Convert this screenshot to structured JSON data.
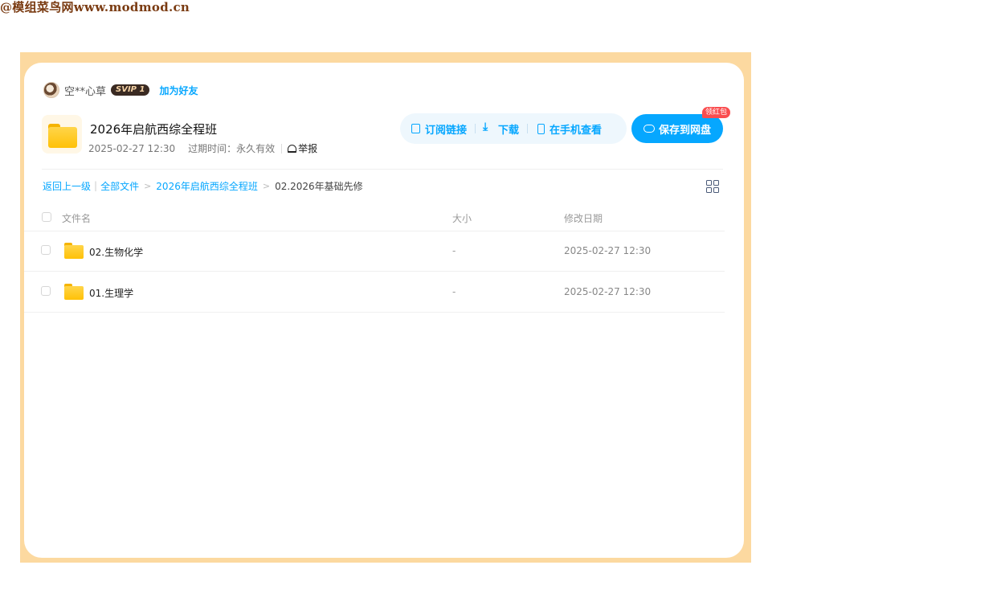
{
  "watermark": "@模组菜鸟网www.modmod.cn",
  "user": {
    "name": "空**心草",
    "badge": "SVIP 1",
    "add_friend": "加为好友"
  },
  "share": {
    "title": "2026年启航西综全程班",
    "time": "2025-02-27 12:30",
    "expire": "过期时间：永久有效",
    "report": "举报"
  },
  "actions": {
    "subscribe": "订阅链接",
    "download": "下载",
    "mobile": "在手机查看",
    "save": "保存到网盘",
    "badge": "领红包"
  },
  "breadcrumb": {
    "back": "返回上一级",
    "all": "全部文件",
    "parent": "2026年启航西综全程班",
    "current": "02.2026年基础先修"
  },
  "table": {
    "headers": {
      "name": "文件名",
      "size": "大小",
      "date": "修改日期"
    },
    "rows": [
      {
        "name": "02.生物化学",
        "size": "-",
        "date": "2025-02-27 12:30"
      },
      {
        "name": "01.生理学",
        "size": "-",
        "date": "2025-02-27 12:30"
      }
    ]
  },
  "colors": {
    "accent": "#06a7ff",
    "frame": "#fcd9a0",
    "folder": "#ffc107"
  }
}
